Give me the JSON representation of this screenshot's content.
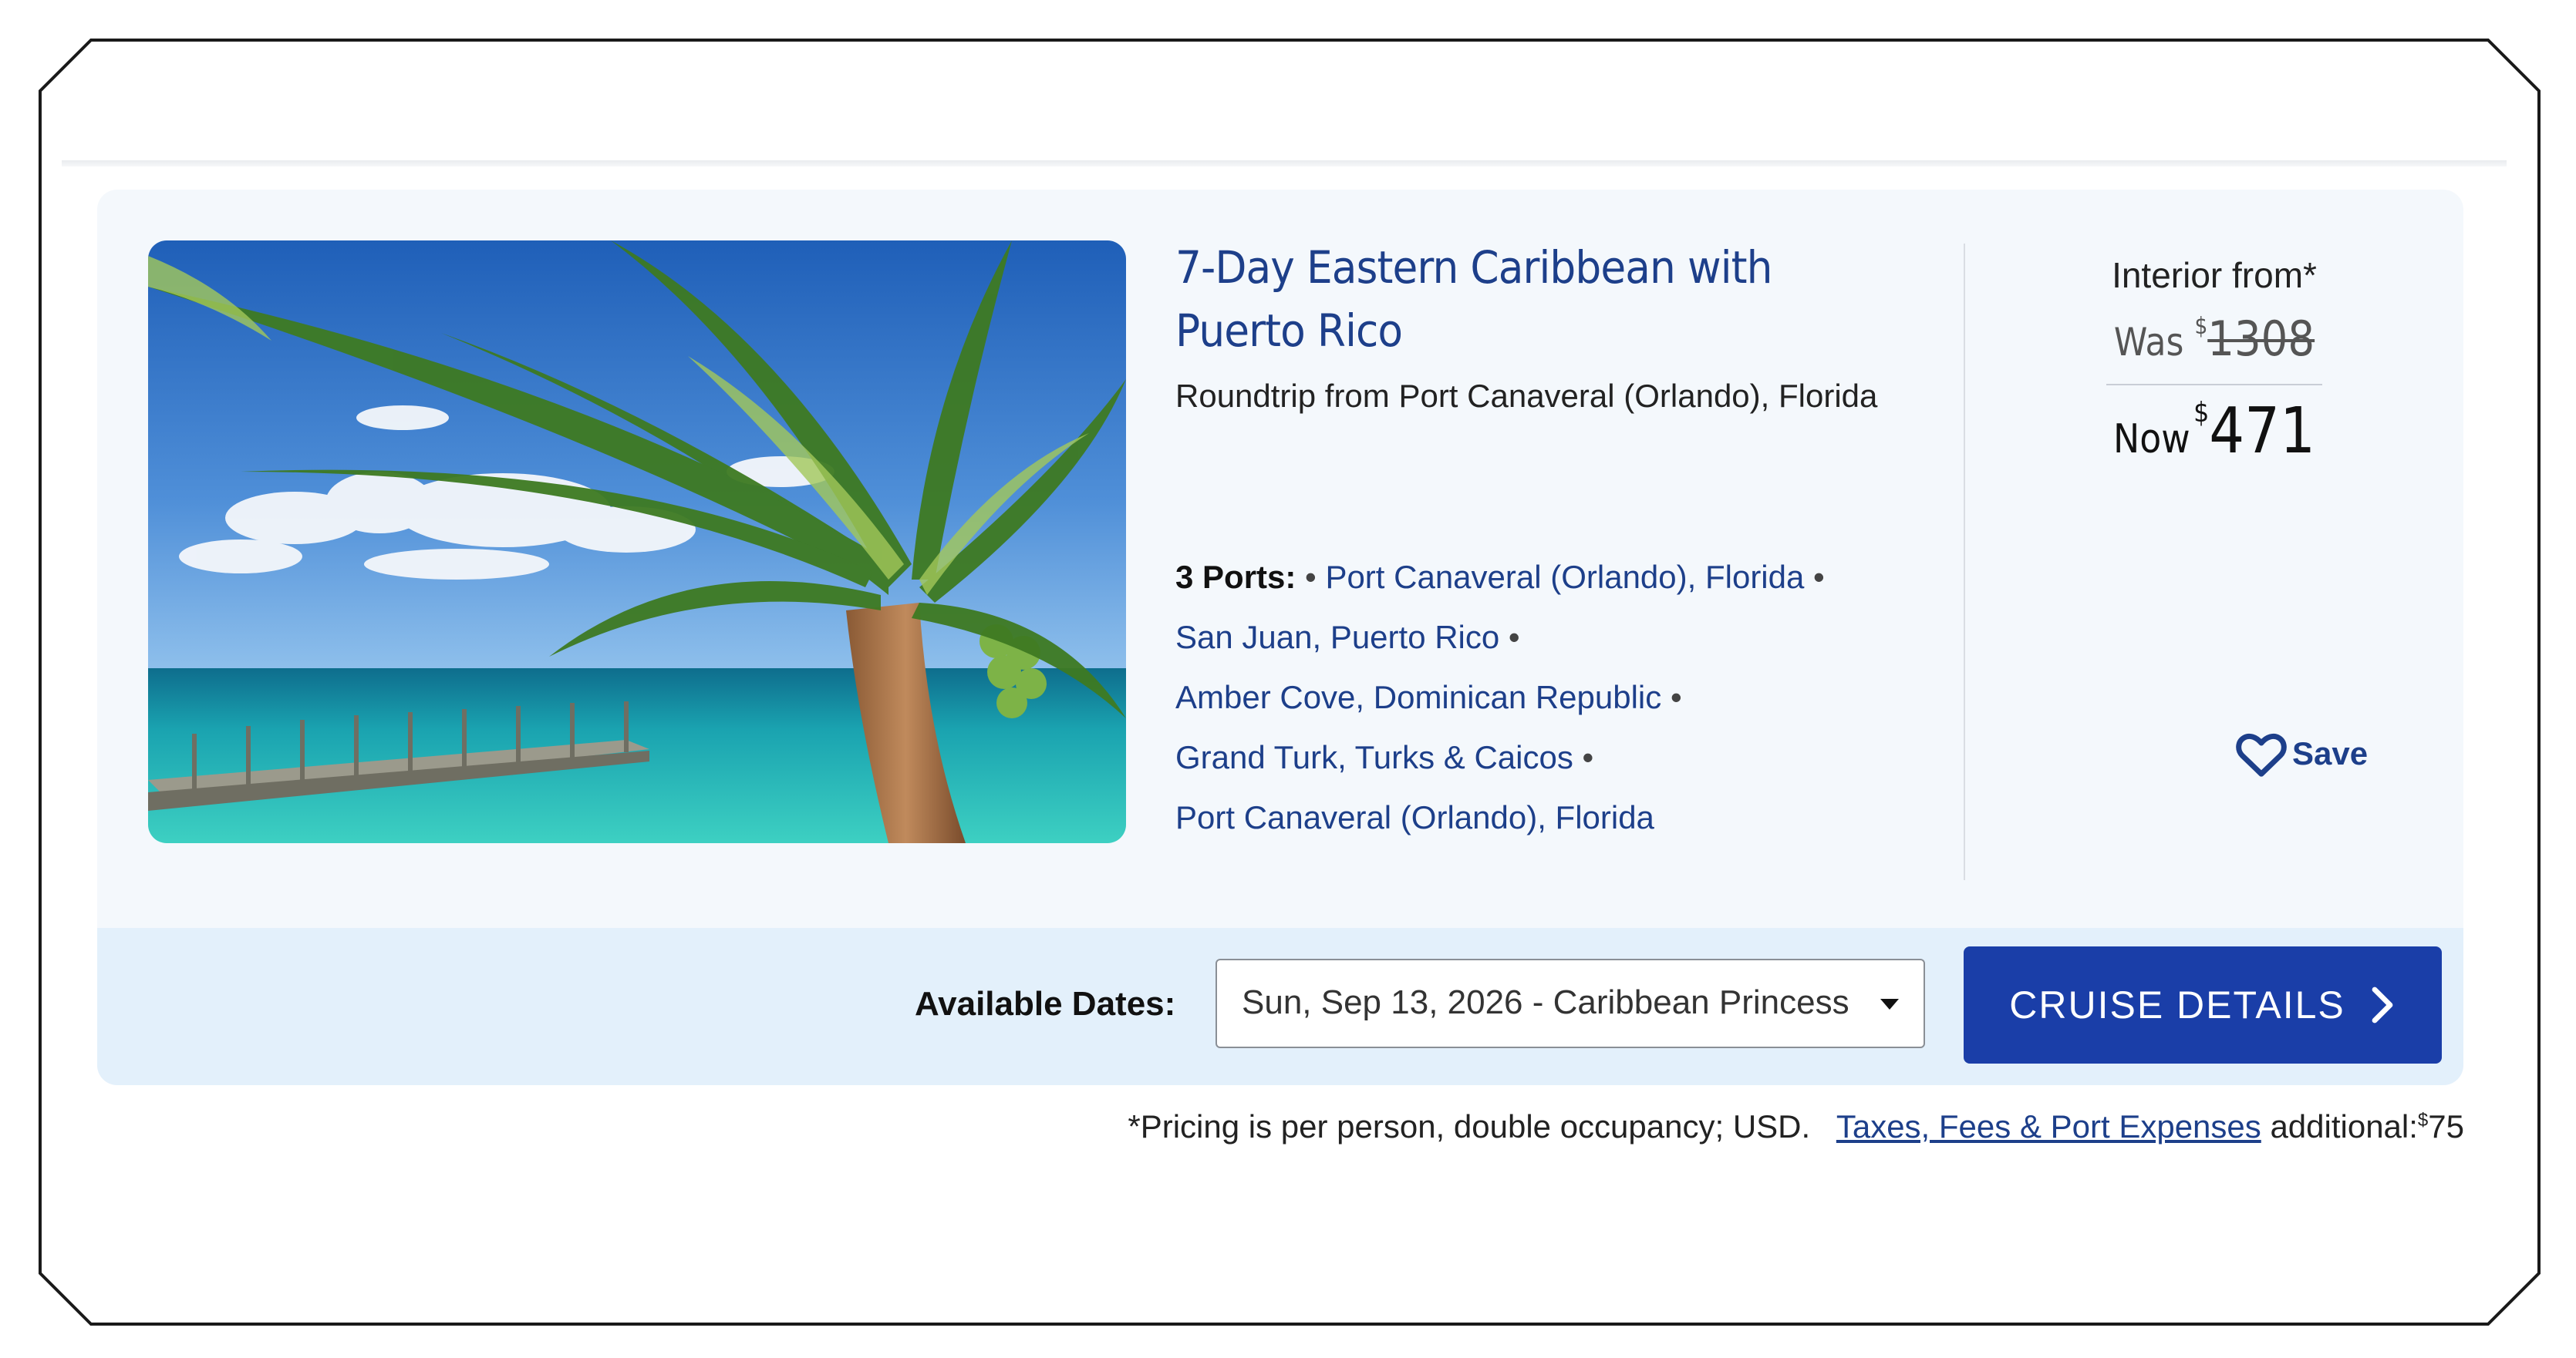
{
  "cruise": {
    "title": "7-Day Eastern Caribbean with Puerto Rico",
    "route": "Roundtrip from Port Canaveral (Orlando), Florida",
    "ports_label": "3 Ports:",
    "ports": [
      "Port Canaveral (Orlando), Florida",
      "San Juan, Puerto Rico",
      "Amber Cove, Dominican Republic",
      "Grand Turk, Turks & Caicos",
      "Port Canaveral (Orlando), Florida"
    ],
    "bullet": "•"
  },
  "pricing": {
    "cabin_label": "Interior from*",
    "was_label": "Was",
    "currency_symbol": "$",
    "was_amount": "1308",
    "now_label": "Now",
    "now_amount": "471"
  },
  "save": {
    "label": "Save",
    "icon": "heart-outline-icon"
  },
  "dates": {
    "label": "Available Dates:",
    "selected": "Sun, Sep 13, 2026 - Caribbean Princess"
  },
  "cta": {
    "label": "CRUISE DETAILS",
    "icon": "chevron-right-icon"
  },
  "footnote": {
    "text": "*Pricing is per person, double occupancy; USD.",
    "link": "Taxes, Fees & Port Expenses",
    "additional": "additional:",
    "fee_currency": "$",
    "fee_amount": "75"
  },
  "colors": {
    "brand_blue": "#1d3f8a",
    "button_blue": "#1a3ea8",
    "card_bg": "#f4f8fc",
    "dates_bar_bg": "#e3f0fb"
  }
}
